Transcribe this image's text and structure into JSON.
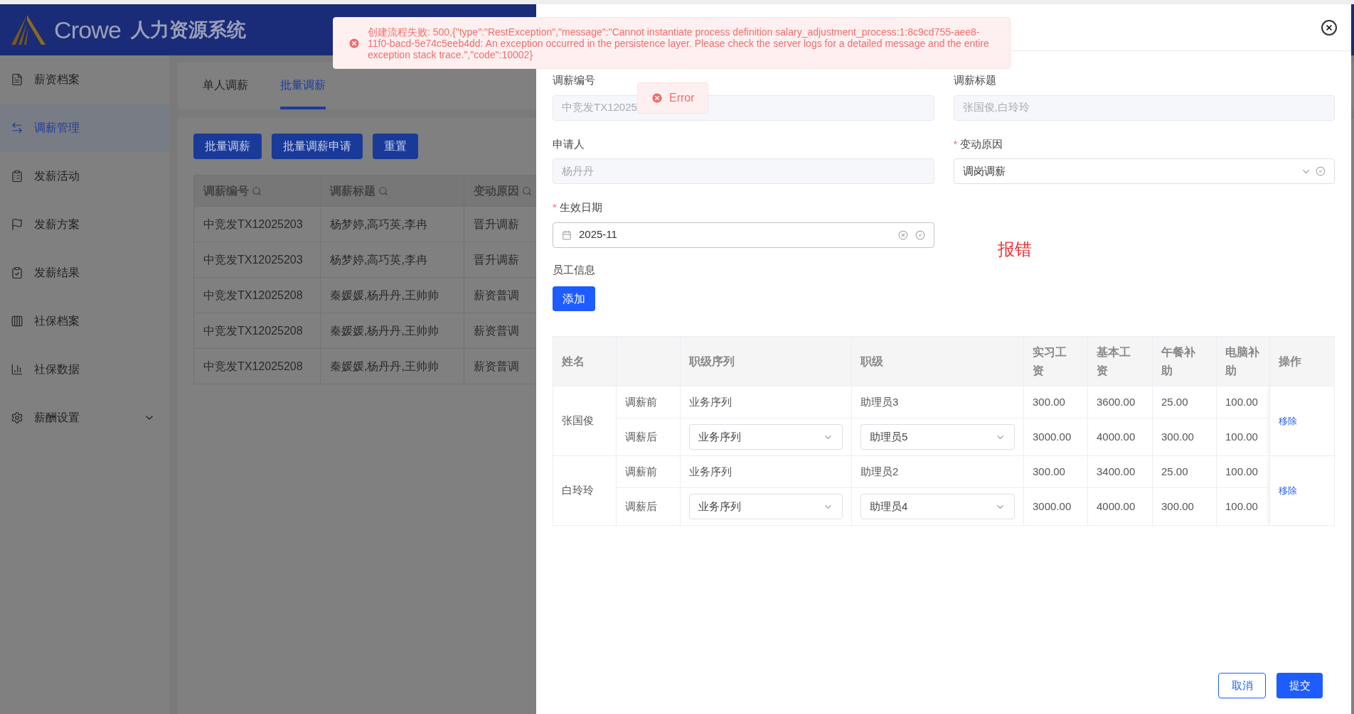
{
  "app": {
    "logo_text": "Crowe",
    "system_name": "人力资源系统"
  },
  "sidebar": {
    "items": [
      {
        "label": "薪资档案",
        "selected": false,
        "kind": "link"
      },
      {
        "label": "调薪管理",
        "selected": true,
        "kind": "link"
      },
      {
        "label": "发薪活动",
        "selected": false,
        "kind": "link"
      },
      {
        "label": "发薪方案",
        "selected": false,
        "kind": "link"
      },
      {
        "label": "发薪结果",
        "selected": false,
        "kind": "link"
      },
      {
        "label": "社保档案",
        "selected": false,
        "kind": "link"
      },
      {
        "label": "社保数据",
        "selected": false,
        "kind": "link"
      },
      {
        "label": "薪酬设置",
        "selected": false,
        "kind": "submenu"
      }
    ]
  },
  "tabs": [
    {
      "label": "单人调薪",
      "selected": false
    },
    {
      "label": "批量调薪",
      "selected": true
    }
  ],
  "toolbar": {
    "buttons": [
      "批量调薪",
      "批量调薪申请",
      "重置"
    ]
  },
  "list_table": {
    "columns": [
      "调薪编号",
      "调薪标题",
      "变动原因"
    ],
    "rows": [
      [
        "中竞发TX12025203",
        "杨梦婷,高巧英,李冉",
        "晋升调薪"
      ],
      [
        "中竞发TX12025203",
        "杨梦婷,高巧英,李冉",
        "晋升调薪"
      ],
      [
        "中竞发TX12025208",
        "秦媛媛,杨丹丹,王帅帅",
        "薪资普调"
      ],
      [
        "中竞发TX12025208",
        "秦媛媛,杨丹丹,王帅帅",
        "薪资普调"
      ],
      [
        "中竞发TX12025208",
        "秦媛媛,杨丹丹,王帅帅",
        "薪资普调"
      ]
    ]
  },
  "error_toast": {
    "message": "创建流程失败: 500,{\"type\":\"RestException\",\"message\":\"Cannot instantiate process definition salary_adjustment_process:1:8c9cd755-aee8-11f0-bacd-5e74c5eeb4dd: An exception occurred in the persistence layer. Please check the server logs for a detailed message and the entire exception stack trace.\",\"code\":10002}"
  },
  "small_toast": {
    "message": "Error"
  },
  "drawer": {
    "fields": [
      {
        "label": "调薪编号",
        "value": "中竞发TX12025",
        "kind": "readonly",
        "required": false
      },
      {
        "label": "调薪标题",
        "value": "张国俊,白玲玲",
        "kind": "readonly",
        "required": false
      },
      {
        "label": "申请人",
        "value": "杨丹丹",
        "kind": "readonly",
        "required": false
      },
      {
        "label": "变动原因",
        "value": "调岗调薪",
        "kind": "select",
        "required": true
      },
      {
        "label": "生效日期",
        "value": "2025-11",
        "kind": "date",
        "required": true
      }
    ],
    "required_mark": "*",
    "annotation": "报错",
    "section_label": "员工信息",
    "add_button": "添加",
    "employee_table": {
      "columns": [
        "姓名",
        "",
        "职级序列",
        "职级",
        "实习工资",
        "基本工资",
        "午餐补助",
        "电脑补助",
        "操作"
      ],
      "employees": [
        {
          "name": "张国俊",
          "action": "移除",
          "rows": [
            {
              "label": "调薪前",
              "kind": "text",
              "series": "业务序列",
              "grade": "助理员3",
              "values": [
                "300.00",
                "3600.00",
                "25.00",
                "100.00"
              ]
            },
            {
              "label": "调薪后",
              "kind": "select",
              "series": "业务序列",
              "grade": "助理员5",
              "values": [
                "3000.00",
                "4000.00",
                "300.00",
                "100.00"
              ]
            }
          ]
        },
        {
          "name": "白玲玲",
          "action": "移除",
          "rows": [
            {
              "label": "调薪前",
              "kind": "text",
              "series": "业务序列",
              "grade": "助理员2",
              "values": [
                "300.00",
                "3400.00",
                "25.00",
                "100.00"
              ]
            },
            {
              "label": "调薪后",
              "kind": "select",
              "series": "业务序列",
              "grade": "助理员4",
              "values": [
                "3000.00",
                "4000.00",
                "300.00",
                "100.00"
              ]
            }
          ]
        }
      ]
    },
    "buttons": [
      "取消",
      "提交"
    ]
  }
}
